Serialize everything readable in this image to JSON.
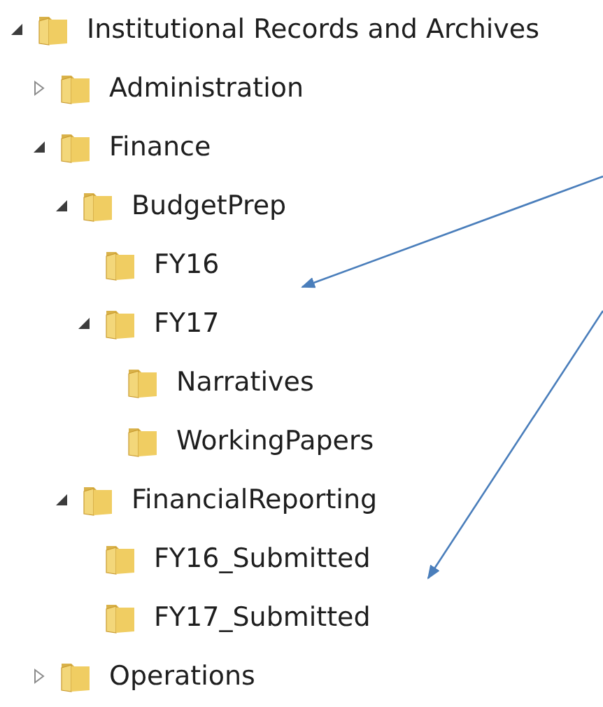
{
  "tree": [
    {
      "label": "Institutional Records and Archives",
      "expanded": true,
      "children": [
        {
          "label": "Administration",
          "expanded": false
        },
        {
          "label": "Finance",
          "expanded": true,
          "children": [
            {
              "label": "BudgetPrep",
              "expanded": true,
              "children": [
                {
                  "label": "FY16"
                },
                {
                  "label": "FY17",
                  "expanded": true,
                  "children": [
                    {
                      "label": "Narratives"
                    },
                    {
                      "label": "WorkingPapers"
                    }
                  ]
                }
              ]
            },
            {
              "label": "FinancialReporting",
              "expanded": true,
              "children": [
                {
                  "label": "FY16_Submitted"
                },
                {
                  "label": "FY17_Submitted"
                }
              ]
            }
          ]
        },
        {
          "label": "Operations",
          "expanded": false
        }
      ]
    }
  ]
}
